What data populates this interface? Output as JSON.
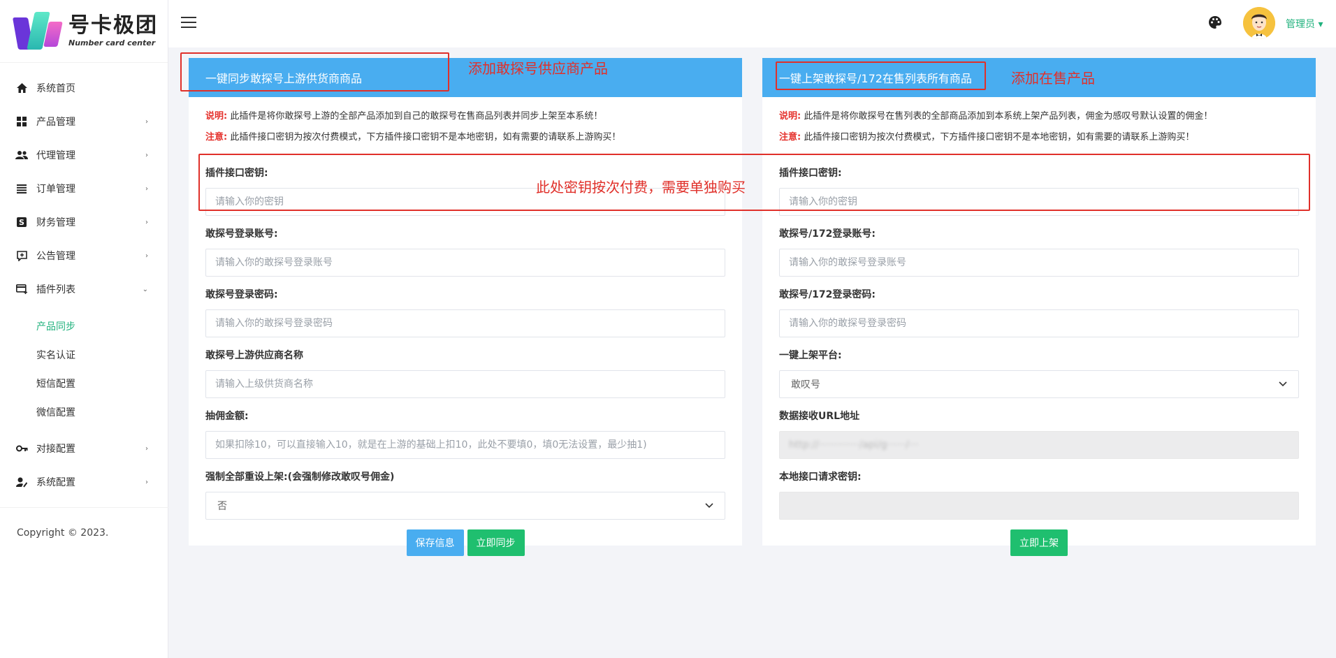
{
  "brand": {
    "title": "号卡极团",
    "subtitle": "Number card center"
  },
  "sidebar": {
    "items": [
      {
        "label": "系统首页",
        "icon": "home-icon",
        "arrow": ""
      },
      {
        "label": "产品管理",
        "icon": "grid-icon",
        "arrow": "›"
      },
      {
        "label": "代理管理",
        "icon": "users-icon",
        "arrow": "›"
      },
      {
        "label": "订单管理",
        "icon": "list-icon",
        "arrow": "›"
      },
      {
        "label": "财务管理",
        "icon": "dollar-icon",
        "arrow": "›"
      },
      {
        "label": "公告管理",
        "icon": "announcement-icon",
        "arrow": "›"
      },
      {
        "label": "插件列表",
        "icon": "plugin-icon",
        "arrow": "⌄"
      }
    ],
    "subitems": [
      {
        "label": "产品同步",
        "active": true
      },
      {
        "label": "实名认证"
      },
      {
        "label": "短信配置"
      },
      {
        "label": "微信配置"
      }
    ],
    "items_after": [
      {
        "label": "对接配置",
        "icon": "key-icon",
        "arrow": "›"
      },
      {
        "label": "系统配置",
        "icon": "user-settings-icon",
        "arrow": "›"
      }
    ],
    "copyright": "Copyright © 2023."
  },
  "header": {
    "user": "管理员 ▾"
  },
  "left_panel": {
    "title": "一键同步敢探号上游供货商商品",
    "note1_label": "说明:",
    "note1_text": " 此插件是将你敢探号上游的全部产品添加到自己的敢探号在售商品列表并同步上架至本系统！",
    "note2_label": "注意:",
    "note2_text": " 此插件接口密钥为按次付费模式，下方插件接口密钥不是本地密钥，如有需要的请联系上游购买！",
    "fields": {
      "key_label": "插件接口密钥:",
      "key_placeholder": "请输入你的密钥",
      "account_label": "敢探号登录账号:",
      "account_placeholder": "请输入你的敢探号登录账号",
      "password_label": "敢探号登录密码:",
      "password_placeholder": "请输入你的敢探号登录密码",
      "supplier_label": "敢探号上游供应商名称",
      "supplier_placeholder": "请输入上级供货商名称",
      "commission_label": "抽佣金额:",
      "commission_placeholder": "如果扣除10，可以直接输入10，就是在上游的基础上扣10，此处不要填0，填0无法设置，最少抽1)",
      "force_label": "强制全部重设上架:(会强制修改敢叹号佣金)",
      "force_value": "否"
    },
    "save_button": "保存信息",
    "sync_button": "立即同步"
  },
  "right_panel": {
    "title": "一键上架敢探号/172在售列表所有商品",
    "note1_label": "说明:",
    "note1_text": " 此插件是将你敢探号在售列表的全部商品添加到本系统上架产品列表，佣金为感叹号默认设置的佣金！",
    "note2_label": "注意:",
    "note2_text": " 此插件接口密钥为按次付费模式，下方插件接口密钥不是本地密钥，如有需要的请联系上游购买！",
    "fields": {
      "key_label": "插件接口密钥:",
      "key_placeholder": "请输入你的密钥",
      "account_label": "敢探号/172登录账号:",
      "account_placeholder": "请输入你的敢探号登录账号",
      "password_label": "敢探号/172登录密码:",
      "password_placeholder": "请输入你的敢探号登录密码",
      "platform_label": "一键上架平台:",
      "platform_value": "敢叹号",
      "url_label": "数据接收URL地址",
      "url_value": "http://·············/api/g······/···",
      "local_key_label": "本地接口请求密钥:"
    },
    "list_button": "立即上架"
  },
  "annotations": {
    "left_title": "添加敢探号供应商产品",
    "right_title": "添加在售产品",
    "key_note": "此处密钥按次付费，需要单独购买"
  },
  "colors": {
    "accent": "#49adf0",
    "green": "#1fbf6f",
    "active": "#20b27d",
    "annotation": "#e0302a"
  }
}
